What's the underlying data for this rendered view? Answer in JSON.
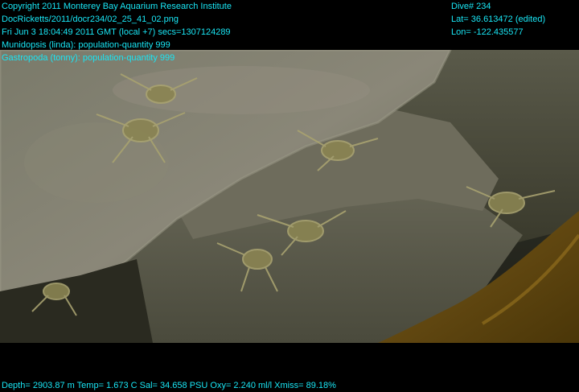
{
  "colors": {
    "overlay_text": "#19E6F5",
    "background": "#000000"
  },
  "header_left": {
    "copyright": "Copyright 2011 Monterey Bay Aquarium Research Institute",
    "file_path": "DocRicketts/2011/docr234/02_25_41_02.png",
    "datetime": "Fri Jun  3 18:04:49 2011 GMT (local +7)  secs=1307124289",
    "annotations": [
      "Munidopsis (linda): population-quantity 999",
      "Gastropoda (tonny): population-quantity 999"
    ]
  },
  "header_right": {
    "dive": "Dive# 234",
    "lat": "Lat= 36.613472 (edited)",
    "lon": "Lon= -122.435577"
  },
  "footer": {
    "sensors": "Depth= 2903.87 m  Temp= 1.673 C  Sal= 34.658 PSU  Oxy= 2.240 ml/l  Xmiss= 89.18%"
  }
}
